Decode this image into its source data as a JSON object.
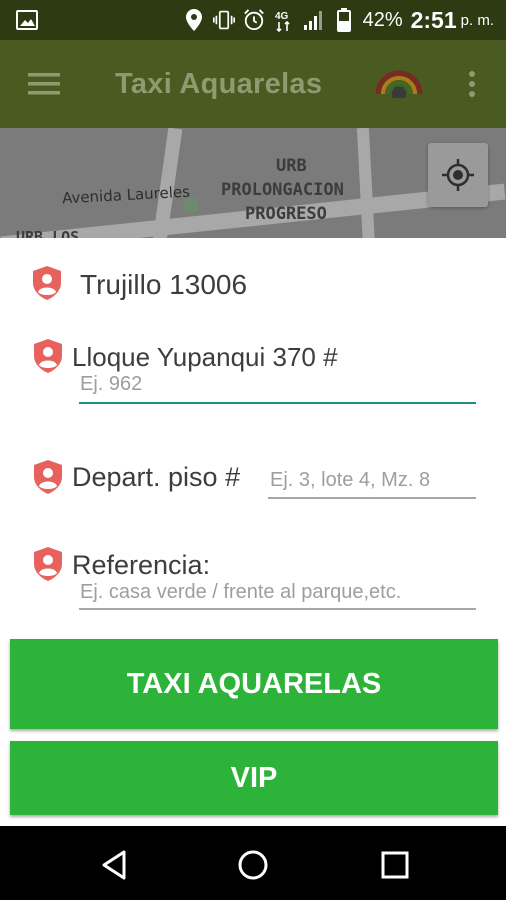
{
  "status_bar": {
    "battery": "42%",
    "time": "2:51",
    "ampm": "p. m.",
    "network": "4G",
    "icons": [
      "image-icon",
      "location-icon",
      "vibrate-icon",
      "alarm-icon",
      "network-4g-icon",
      "signal-icon",
      "battery-icon"
    ]
  },
  "toolbar": {
    "title": "Taxi Aquarelas",
    "menu_icon": "hamburger-menu-icon",
    "overflow_icon": "more-vert-icon"
  },
  "map": {
    "labels": {
      "street": "Avenida Laureles",
      "urb_line1": "URB",
      "urb_line2": "PROLONGACION",
      "urb_line3": "PROGRESO",
      "urb_los": "URB LOS"
    },
    "locate_icon": "my-location-icon"
  },
  "form": {
    "city": "Trujillo 13006",
    "address": {
      "label": "Lloque Yupanqui 370 #",
      "placeholder": "Ej. 962"
    },
    "apartment": {
      "label": "Depart. piso #",
      "placeholder": "Ej. 3, lote 4, Mz. 8"
    },
    "reference": {
      "label": "Referencia:",
      "placeholder": "Ej. casa verde / frente al parque,etc."
    },
    "pin_color": "#e8625d",
    "accent_color": "#1f8f84"
  },
  "buttons": {
    "primary": "TAXI AQUARELAS",
    "secondary": "VIP",
    "color": "#2db33a"
  },
  "nav": {
    "icons": [
      "back-icon",
      "home-icon",
      "recents-icon"
    ]
  }
}
